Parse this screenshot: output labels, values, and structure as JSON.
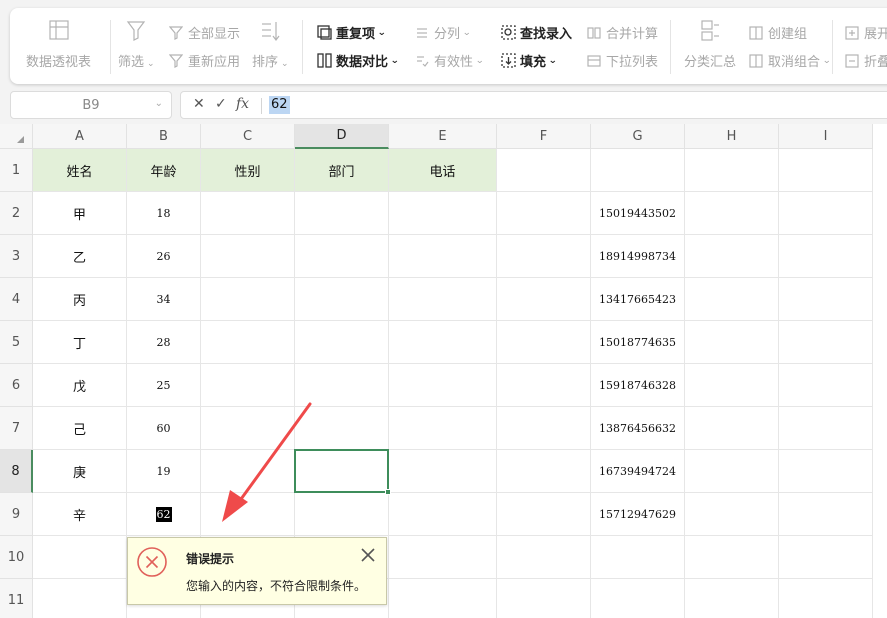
{
  "ribbon": {
    "pivot_table": "数据透视表",
    "filter": "筛选",
    "show_all": "全部显示",
    "reapply": "重新应用",
    "sort": "排序",
    "duplicates": "重复项",
    "data_compare": "数据对比",
    "split_column": "分列",
    "validity": "有效性",
    "find_entry": "查找录入",
    "fill": "填充",
    "merge_calc": "合并计算",
    "dropdown_list": "下拉列表",
    "subtotal": "分类汇总",
    "create_group": "创建组",
    "ungroup": "取消组合",
    "expand": "展开",
    "fold": "折叠"
  },
  "formula_bar": {
    "name_box": "B9",
    "cancel": "✕",
    "confirm": "✓",
    "fx": "fx",
    "value": "62"
  },
  "grid": {
    "corner_icon": "select-all-triangle",
    "columns": [
      "A",
      "B",
      "C",
      "D",
      "E",
      "F",
      "G",
      "H",
      "I"
    ],
    "active_column": "D",
    "rows": [
      "1",
      "2",
      "3",
      "4",
      "5",
      "6",
      "7",
      "8",
      "9",
      "10",
      "11"
    ],
    "active_row": "8",
    "header": [
      "姓名",
      "年龄",
      "性别",
      "部门",
      "电话"
    ],
    "data": [
      {
        "name": "甲",
        "age": "18",
        "phone": "15019443502"
      },
      {
        "name": "乙",
        "age": "26",
        "phone": "18914998734"
      },
      {
        "name": "丙",
        "age": "34",
        "phone": "13417665423"
      },
      {
        "name": "丁",
        "age": "28",
        "phone": "15018774635"
      },
      {
        "name": "戊",
        "age": "25",
        "phone": "15918746328"
      },
      {
        "name": "己",
        "age": "60",
        "phone": "13876456632"
      },
      {
        "name": "庚",
        "age": "19",
        "phone": "16739494724"
      },
      {
        "name": "辛",
        "age": "62",
        "phone": "15712947629"
      }
    ]
  },
  "error_tip": {
    "title": "错误提示",
    "message": "您输入的内容，不符合限制条件。",
    "icon": "error-x-circle-icon",
    "close_icon": "close-icon"
  },
  "colors": {
    "header_fill": "#e3f0d9",
    "selection": "#3e8d5b",
    "error_icon": "#e0605a",
    "annotation_arrow": "#ef4a4a",
    "tooltip_bg": "#ffffe3"
  }
}
